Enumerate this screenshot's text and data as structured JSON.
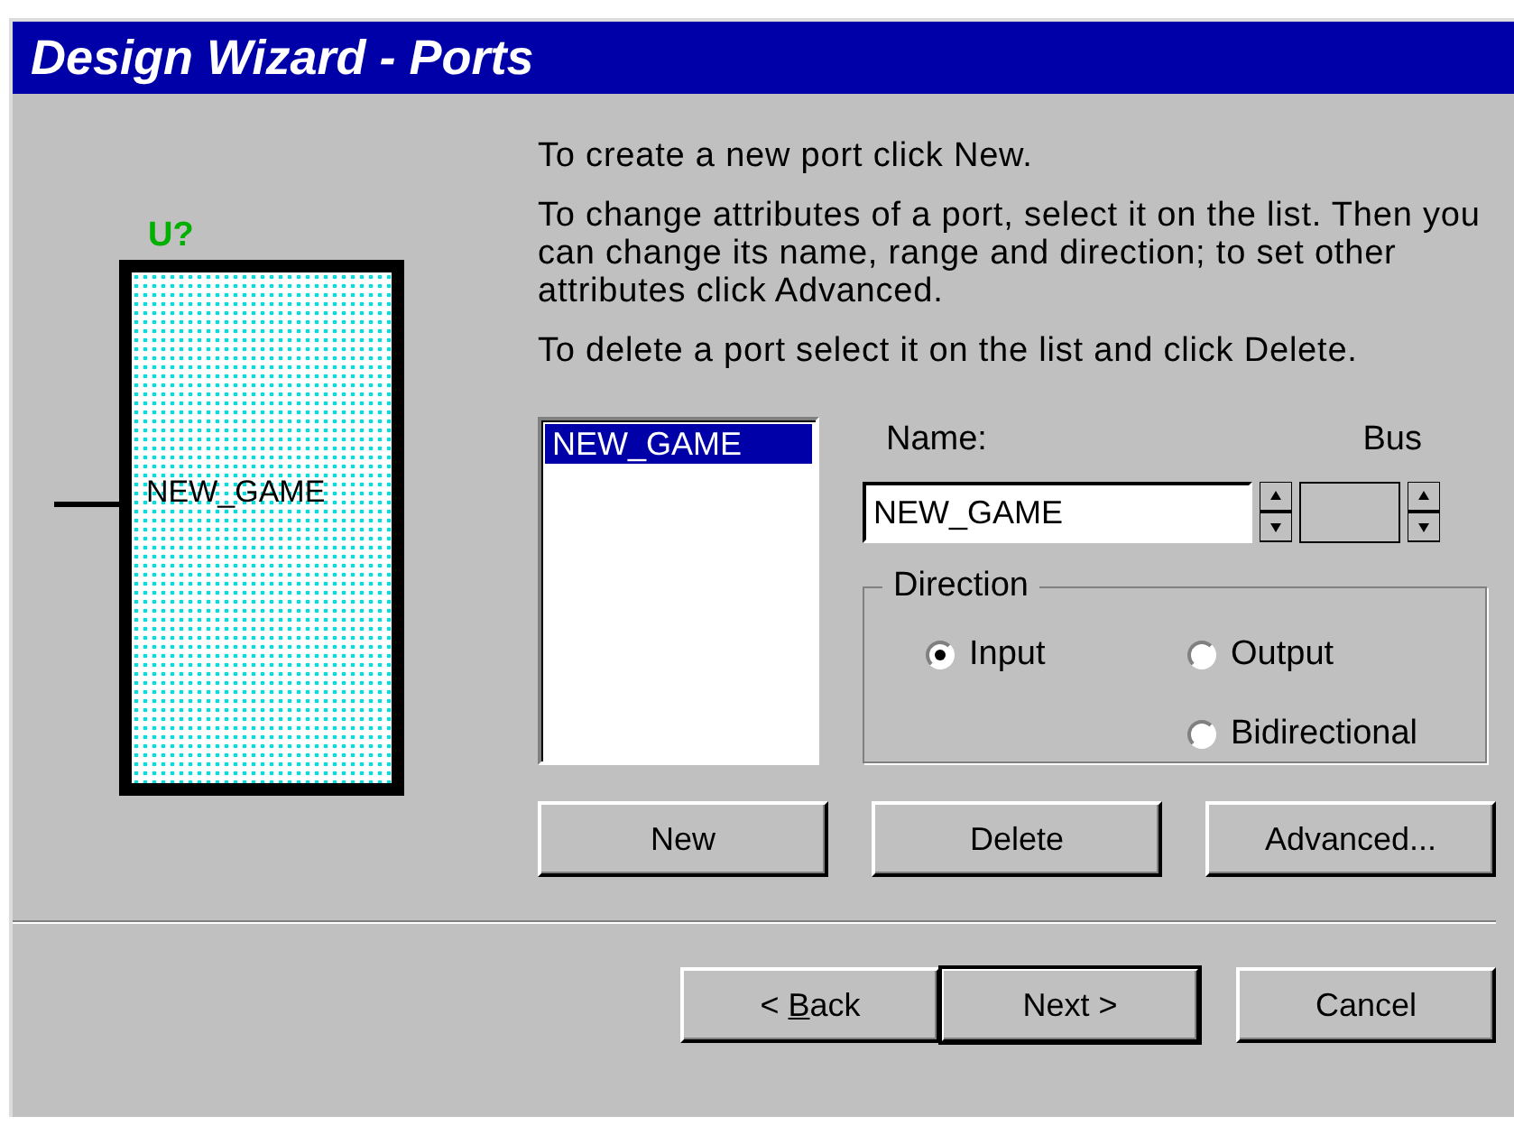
{
  "window": {
    "title": "Design Wizard - Ports"
  },
  "symbol": {
    "reference": "U?",
    "pin_label": "NEW_GAME"
  },
  "instructions": [
    "To create a new port click New.",
    "To change attributes of a port, select it on the list. Then you can change its name, range and direction; to set other attributes click Advanced.",
    "To delete a port select it on the list and click Delete."
  ],
  "port_list": [
    {
      "label": "NEW_GAME",
      "selected": true
    }
  ],
  "name_field": {
    "label": "Name:",
    "value": "NEW_GAME"
  },
  "bus_field": {
    "label": "Bus"
  },
  "direction": {
    "label": "Direction",
    "options": [
      {
        "label": "Input",
        "selected": true
      },
      {
        "label": "Output",
        "selected": false
      },
      {
        "label": "Bidirectional",
        "selected": false
      }
    ]
  },
  "port_buttons": [
    "New",
    "Delete",
    "Advanced..."
  ],
  "nav_buttons": [
    {
      "label_before": "< ",
      "access_key": "B",
      "label_after": "ack",
      "default": false
    },
    {
      "label": "Next >",
      "default": true
    },
    {
      "label": "Cancel",
      "default": false
    }
  ]
}
